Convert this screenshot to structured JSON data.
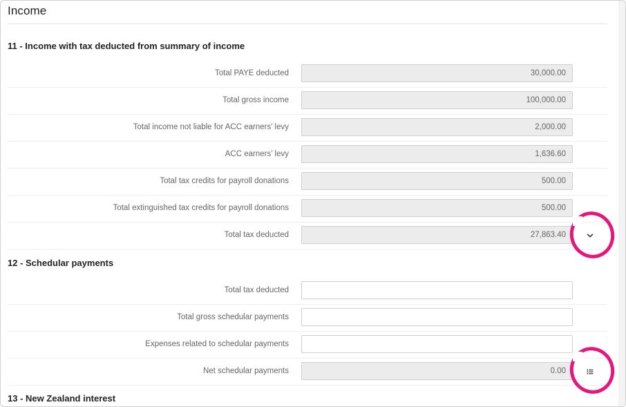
{
  "page": {
    "title": "Income"
  },
  "sections": [
    {
      "heading": "11 - Income with tax deducted from summary of income",
      "rows": [
        {
          "label": "Total PAYE deducted",
          "value": "30,000.00"
        },
        {
          "label": "Total gross income",
          "value": "100,000.00"
        },
        {
          "label": "Total income not liable for ACC earners’ levy",
          "value": "2,000.00"
        },
        {
          "label": "ACC earners’ levy",
          "value": "1,636.60"
        },
        {
          "label": "Total tax credits for payroll donations",
          "value": "500.00"
        },
        {
          "label": "Total extinguished tax credits for payroll donations",
          "value": "500.00"
        },
        {
          "label": "Total tax deducted",
          "value": "27,863.40"
        }
      ]
    },
    {
      "heading": "12 - Schedular payments",
      "rows": [
        {
          "label": "Total tax deducted",
          "value": ""
        },
        {
          "label": "Total gross schedular payments",
          "value": ""
        },
        {
          "label": "Expenses related to schedular payments",
          "value": ""
        },
        {
          "label": "Net schedular payments",
          "value": "0.00"
        }
      ]
    },
    {
      "heading": "13 - New Zealand interest",
      "rows": []
    }
  ],
  "icons": {
    "expand": "chevron-down-icon",
    "details": "list-icon"
  },
  "colors": {
    "highlight": "#e3177c",
    "readonly_field": "#ececec",
    "label_text": "#666666"
  }
}
